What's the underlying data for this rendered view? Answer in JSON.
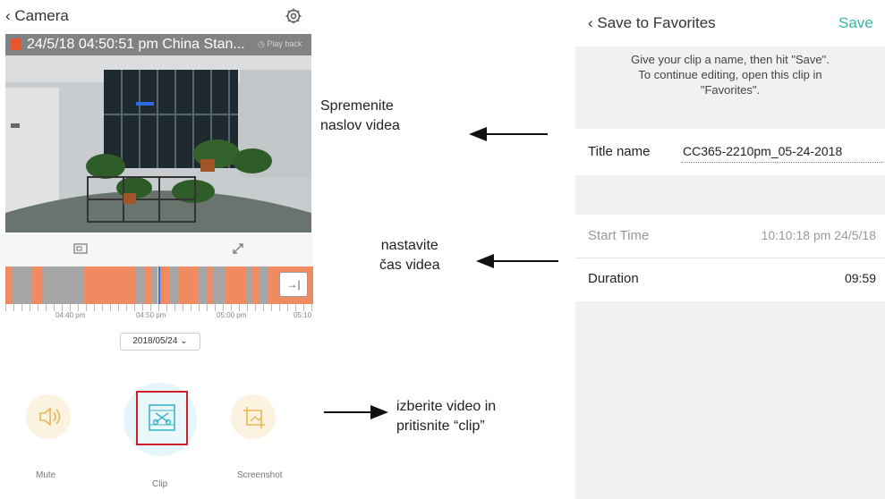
{
  "camera_screen": {
    "back_label": "Camera",
    "video_overlay": {
      "timestamp": "24/5/18 04:50:51 pm China Stan...",
      "playback_label": "Play back"
    },
    "timeline": {
      "tick_labels": [
        "04:40 pm",
        "04:50 pm",
        "05:00 pm",
        "05:10"
      ],
      "jump_label": "→|"
    },
    "date_value": "2018/05/24",
    "controls": [
      {
        "label": "Mute",
        "icon": "speaker-icon"
      },
      {
        "label": "Clip",
        "icon": "scissors-icon"
      },
      {
        "label": "Screenshot",
        "icon": "crop-icon"
      }
    ]
  },
  "annotations": {
    "note1": [
      "Spremenite",
      "naslov videa"
    ],
    "note2": [
      "nastavite",
      "čas videa"
    ],
    "note3": [
      "izberite video in",
      "pritisnite “clip”"
    ]
  },
  "favorites_screen": {
    "back_label": "Save to Favorites",
    "save_label": "Save",
    "message_lines": [
      "Give your clip a name, then hit \"Save\".",
      "To continue editing, open this clip in",
      "\"Favorites\"."
    ],
    "title_label": "Title name",
    "title_value": "CC365-2210pm_05-24-2018",
    "start_label": "Start Time",
    "start_value": "10:10:18 pm 24/5/18",
    "duration_label": "Duration",
    "duration_value": "09:59"
  },
  "colors": {
    "accent_teal": "#33b8a5",
    "timeline_orange": "#f08a60",
    "highlight_red": "#d11f2a",
    "control_cream": "#fbf3df"
  }
}
